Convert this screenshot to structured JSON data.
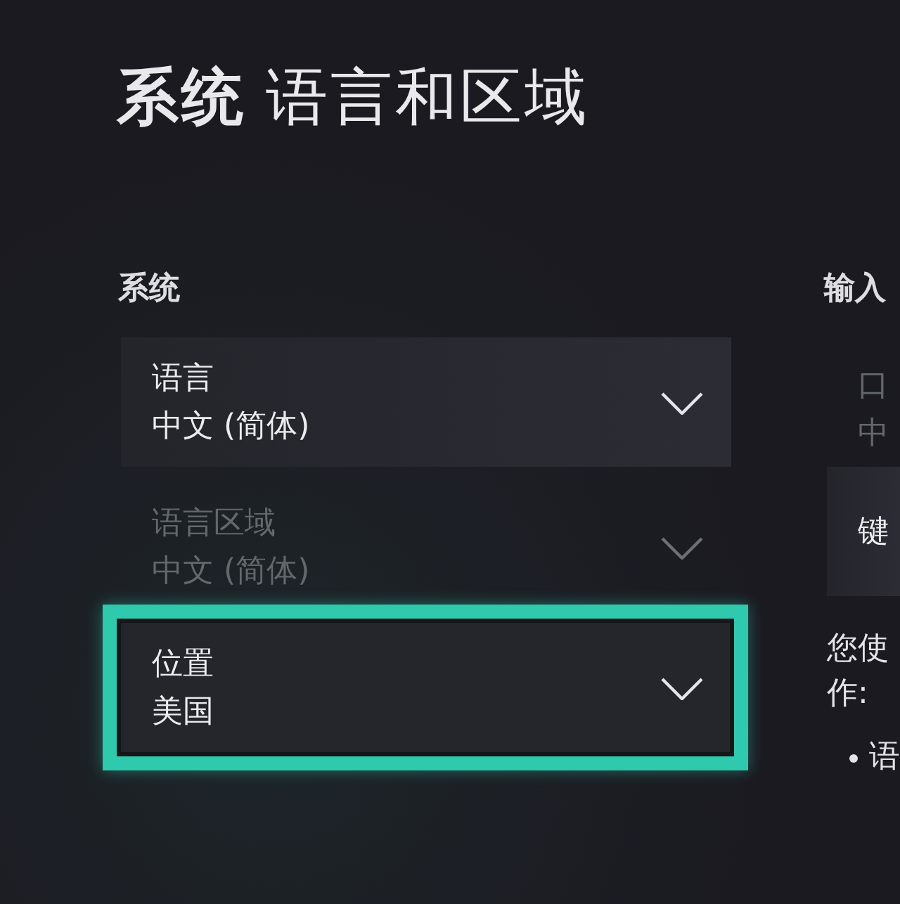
{
  "title": {
    "section": "系统",
    "page": "语言和区域"
  },
  "columns": [
    {
      "heading": "系统",
      "items": [
        {
          "kind": "dropdown",
          "label": "语言",
          "value": "中文 (简体)",
          "disabled": false,
          "selected": false
        },
        {
          "kind": "dropdown",
          "label": "语言区域",
          "value": "中文 (简体)",
          "disabled": true,
          "selected": false
        },
        {
          "kind": "dropdown",
          "label": "位置",
          "value": "美国",
          "disabled": false,
          "selected": true
        }
      ]
    },
    {
      "heading": "输入",
      "items": [
        {
          "kind": "setting",
          "label": "口",
          "value": "中",
          "disabled": true,
          "selected": false
        },
        {
          "kind": "setting",
          "label": "键",
          "disabled": false,
          "selected": false
        }
      ],
      "note_lines": [
        "您使",
        "作:"
      ],
      "bullets": [
        "语"
      ]
    }
  ]
}
